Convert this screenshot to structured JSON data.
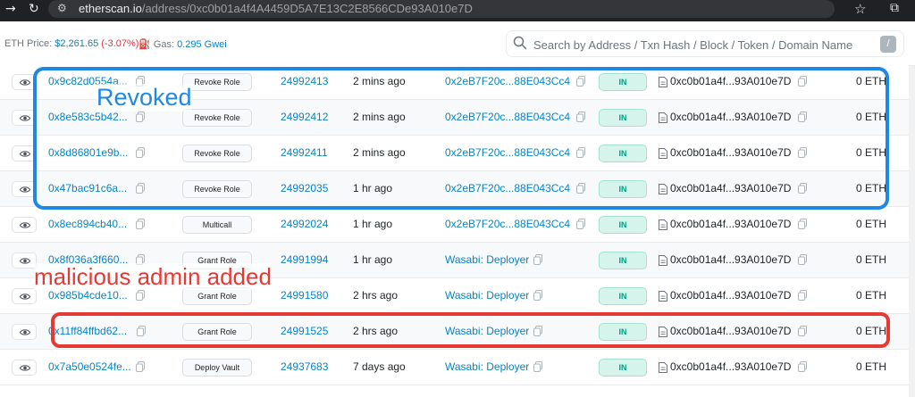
{
  "browser": {
    "url_domain": "etherscan.io",
    "url_path": "/address/0xc0b01a4f4A4459D5A7E13C2E8566CDe93A010e7D"
  },
  "header": {
    "eth_price_label": "ETH Price:",
    "eth_price_value": "$2,261.65",
    "eth_price_change": "(-3.07%)",
    "gas_label": "Gas:",
    "gas_value": "0.295 Gwei",
    "search_placeholder": "Search by Address / Txn Hash / Block / Token / Domain Name",
    "search_shortcut": "/"
  },
  "rows": [
    {
      "hash": "0x9c82d0554a...",
      "method": "Revoke Role",
      "block": "24992413",
      "age": "2 mins ago",
      "from": "0x2eB7F20c...88E043Cc4",
      "direction": "IN",
      "to": "0xc0b01a4f...93A010e7D",
      "amount": "0 ETH"
    },
    {
      "hash": "0x8e583c5b42...",
      "method": "Revoke Role",
      "block": "24992412",
      "age": "2 mins ago",
      "from": "0x2eB7F20c...88E043Cc4",
      "direction": "IN",
      "to": "0xc0b01a4f...93A010e7D",
      "amount": "0 ETH"
    },
    {
      "hash": "0x8d86801e9b...",
      "method": "Revoke Role",
      "block": "24992411",
      "age": "2 mins ago",
      "from": "0x2eB7F20c...88E043Cc4",
      "direction": "IN",
      "to": "0xc0b01a4f...93A010e7D",
      "amount": "0 ETH"
    },
    {
      "hash": "0x47bac91c6a...",
      "method": "Revoke Role",
      "block": "24992035",
      "age": "1 hr ago",
      "from": "0x2eB7F20c...88E043Cc4",
      "direction": "IN",
      "to": "0xc0b01a4f...93A010e7D",
      "amount": "0 ETH"
    },
    {
      "hash": "0x8ec894cb40...",
      "method": "Multicall",
      "block": "24992024",
      "age": "1 hr ago",
      "from": "0x2eB7F20c...88E043Cc4",
      "direction": "IN",
      "to": "0xc0b01a4f...93A010e7D",
      "amount": "0 ETH"
    },
    {
      "hash": "0x8f036a3f660...",
      "method": "Grant Role",
      "block": "24991994",
      "age": "1 hr ago",
      "from": "Wasabi: Deployer",
      "direction": "IN",
      "to": "0xc0b01a4f...93A010e7D",
      "amount": "0 ETH"
    },
    {
      "hash": "0x985b4cde10...",
      "method": "Grant Role",
      "block": "24991580",
      "age": "2 hrs ago",
      "from": "Wasabi: Deployer",
      "direction": "IN",
      "to": "0xc0b01a4f...93A010e7D",
      "amount": "0 ETH"
    },
    {
      "hash": "0x11ff84ffbd62...",
      "method": "Grant Role",
      "block": "24991525",
      "age": "2 hrs ago",
      "from": "Wasabi: Deployer",
      "direction": "IN",
      "to": "0xc0b01a4f...93A010e7D",
      "amount": "0 ETH"
    },
    {
      "hash": "0x7a50e0524fe...",
      "method": "Deploy Vault",
      "block": "24937683",
      "age": "7 days ago",
      "from": "Wasabi: Deployer",
      "direction": "IN",
      "to": "0xc0b01a4f...93A010e7D",
      "amount": "0 ETH"
    }
  ],
  "annotations": {
    "revoked_label": "Revoked",
    "malicious_label": "malicious admin added",
    "revoked_color": "#1e88e5",
    "malicious_color": "#e53935"
  },
  "colors": {
    "link": "#0784c3",
    "in_badge_text": "#00a186",
    "in_badge_bg": "#d6f4ec",
    "negative": "#dc3545"
  }
}
